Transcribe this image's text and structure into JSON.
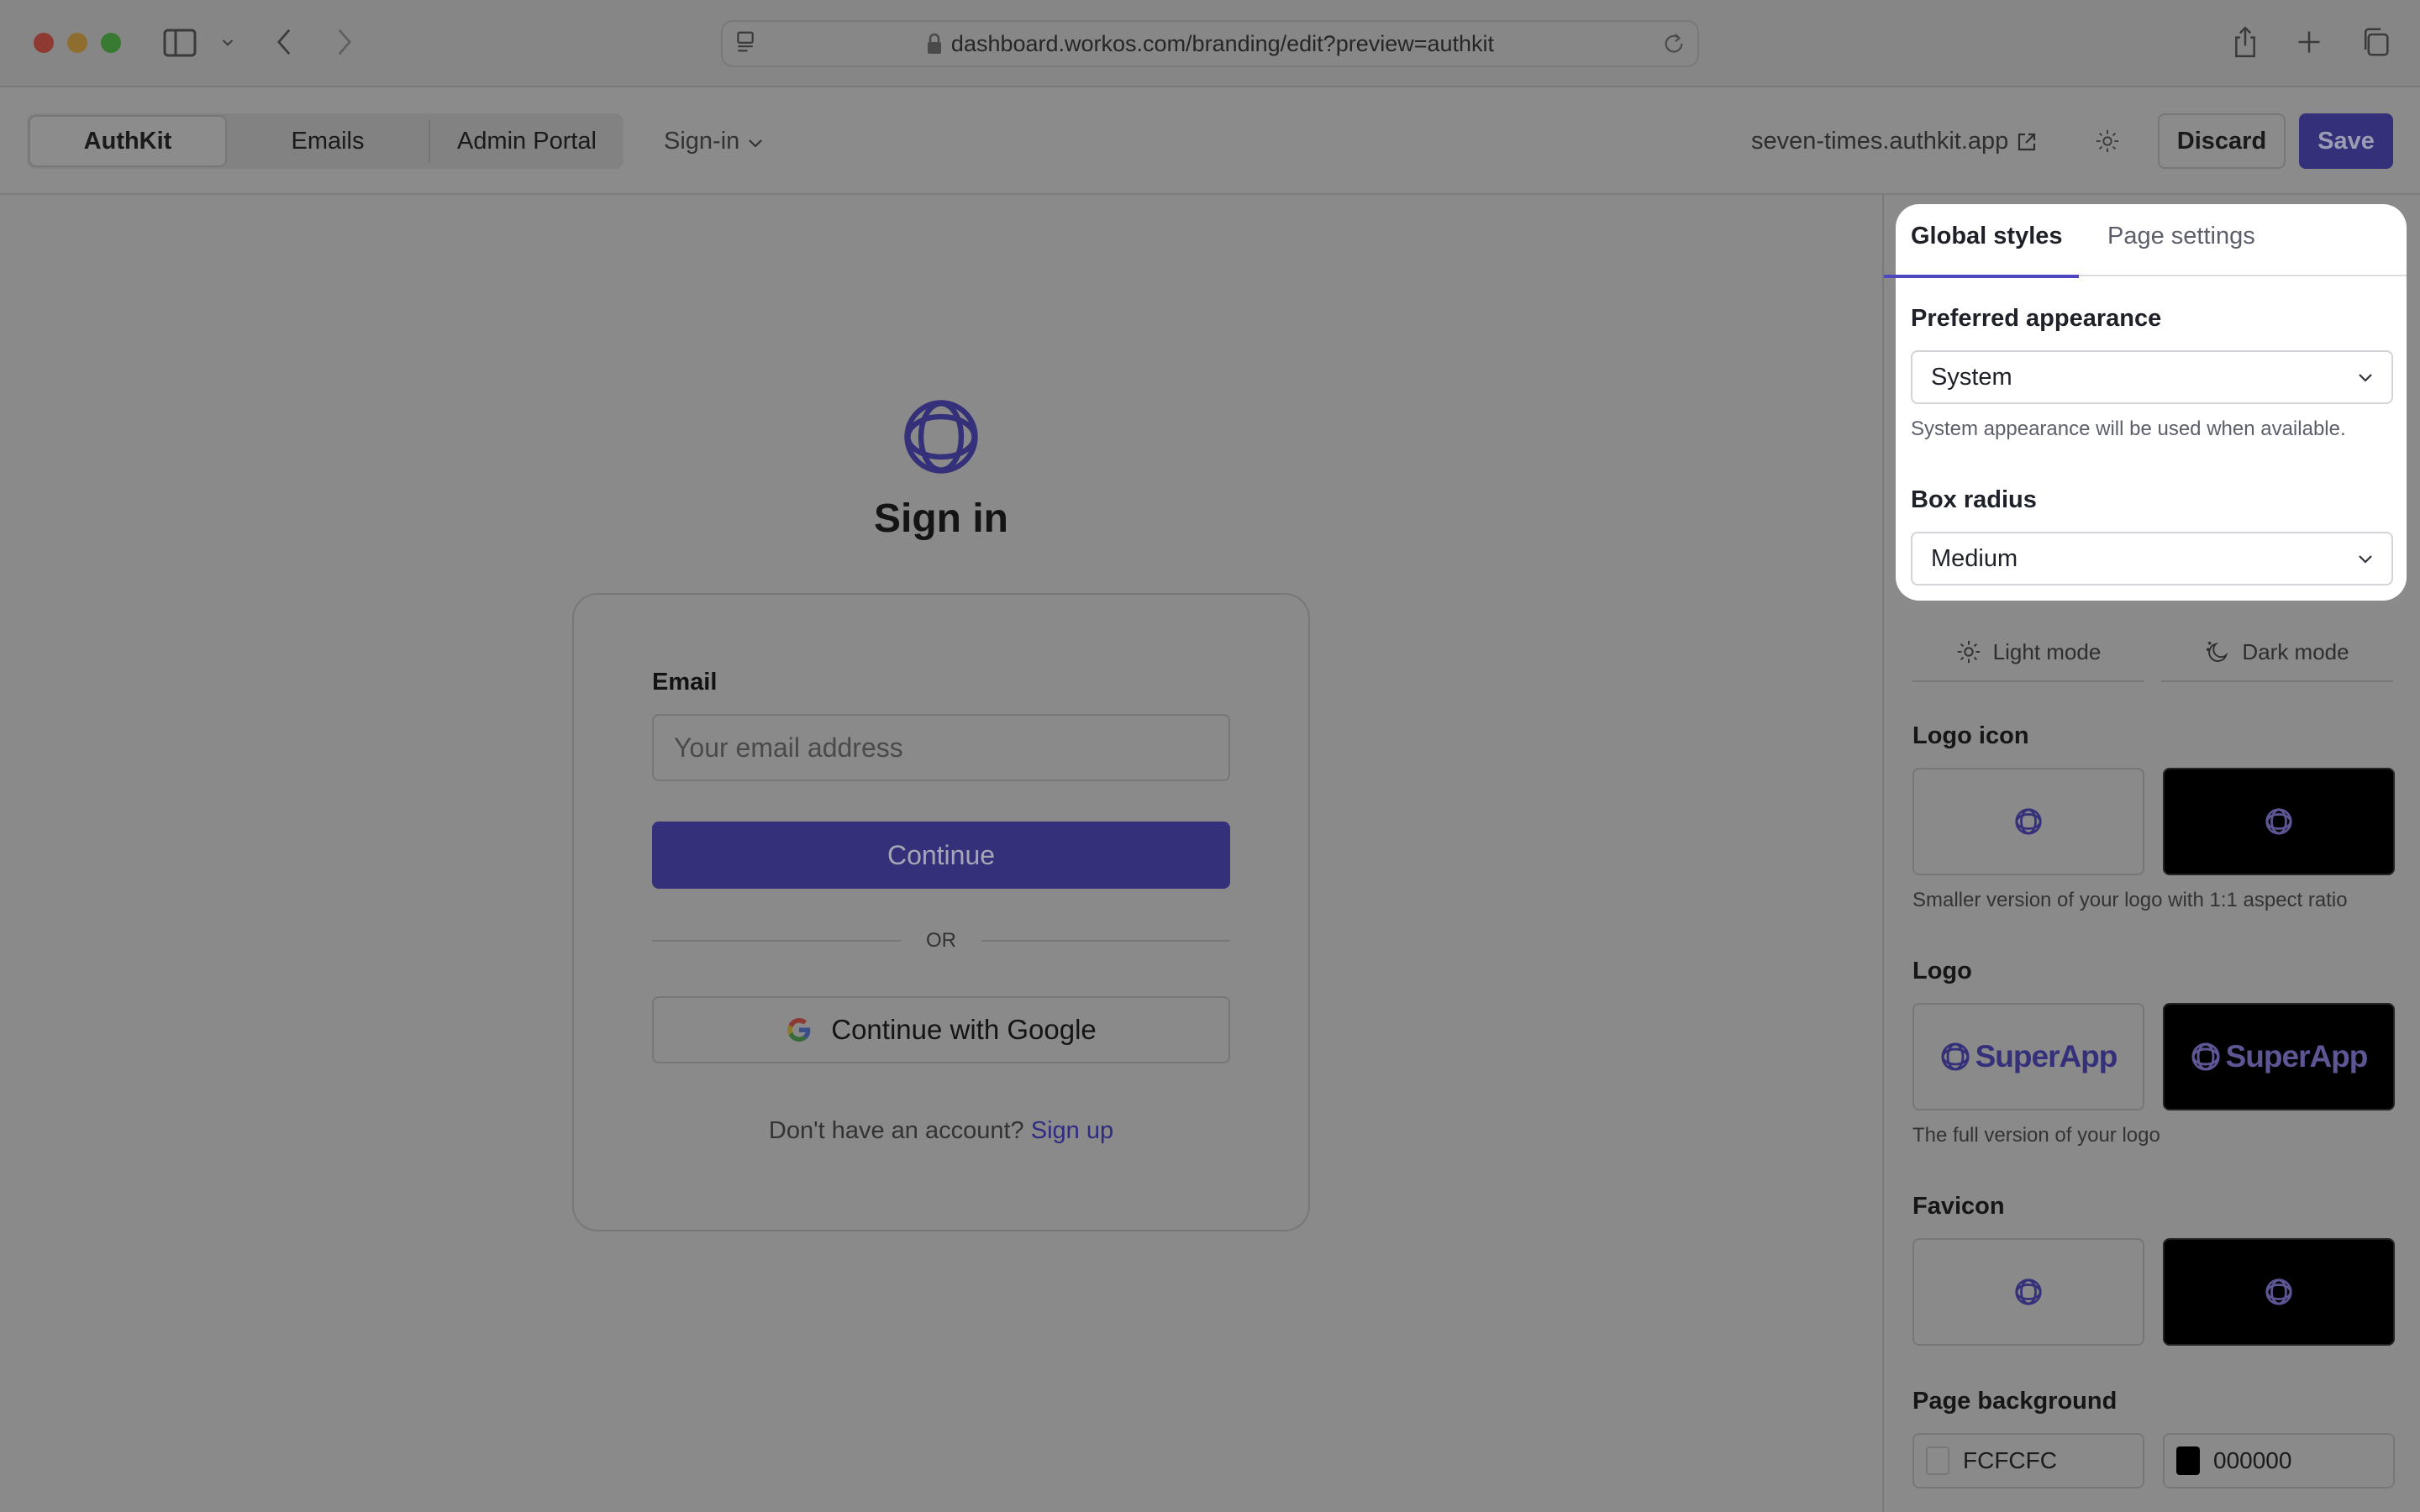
{
  "browser": {
    "url": "dashboard.workos.com/branding/edit?preview=authkit"
  },
  "appbar": {
    "tabs": [
      {
        "label": "AuthKit",
        "active": true
      },
      {
        "label": "Emails",
        "active": false
      },
      {
        "label": "Admin Portal",
        "active": false
      }
    ],
    "page_dropdown": "Sign-in",
    "domain_link": "seven-times.authkit.app",
    "discard_label": "Discard",
    "save_label": "Save"
  },
  "preview": {
    "title": "Sign in",
    "email_label": "Email",
    "email_placeholder": "Your email address",
    "email_value": "",
    "continue_label": "Continue",
    "divider_text": "OR",
    "google_label": "Continue with Google",
    "signup_prompt": "Don't have an account?",
    "signup_link": "Sign up"
  },
  "settings": {
    "tabs": [
      {
        "label": "Global styles",
        "active": true
      },
      {
        "label": "Page settings",
        "active": false
      }
    ],
    "preferred_appearance": {
      "label": "Preferred appearance",
      "value": "System",
      "help": "System appearance will be used when available."
    },
    "box_radius": {
      "label": "Box radius",
      "value": "Medium"
    },
    "mode_tabs": [
      {
        "label": "Light mode",
        "icon": "sun-icon"
      },
      {
        "label": "Dark mode",
        "icon": "moon-icon"
      }
    ],
    "logo_icon": {
      "label": "Logo icon",
      "help": "Smaller version of your logo with 1:1 aspect ratio"
    },
    "logo": {
      "label": "Logo",
      "wordmark": "SuperApp",
      "help": "The full version of your logo"
    },
    "favicon": {
      "label": "Favicon"
    },
    "page_background": {
      "label": "Page background",
      "light_value": "FCFCFC",
      "dark_value": "000000"
    }
  },
  "colors": {
    "brand": "#35307a",
    "tab_underline": "#4f47bf",
    "page_bg_light": "#FCFCFC",
    "page_bg_dark": "#000000"
  }
}
